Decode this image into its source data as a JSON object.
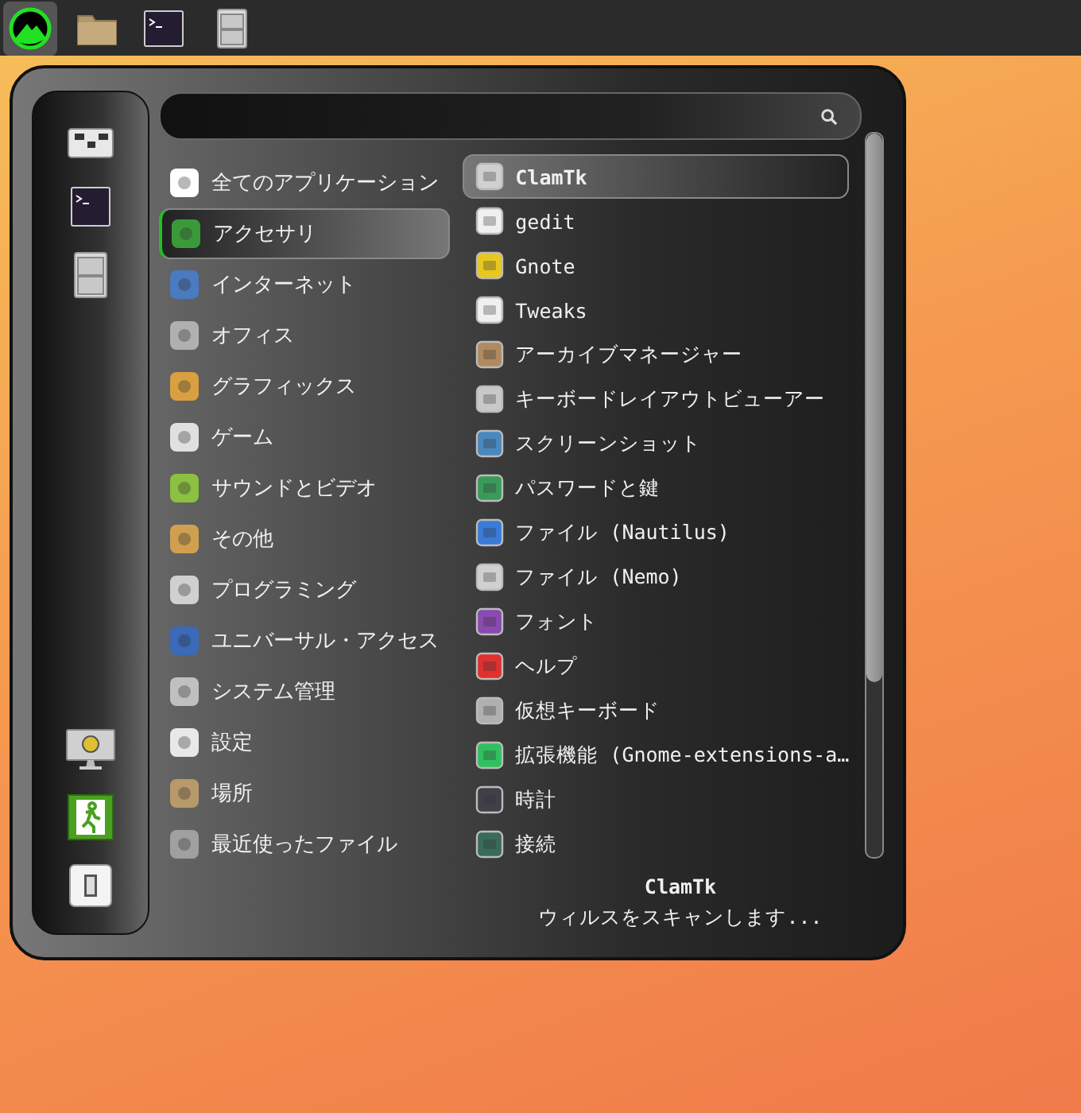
{
  "categories": [
    {
      "label": "全てのアプリケーション",
      "selected": false
    },
    {
      "label": "アクセサリ",
      "selected": true
    },
    {
      "label": "インターネット",
      "selected": false
    },
    {
      "label": "オフィス",
      "selected": false
    },
    {
      "label": "グラフィックス",
      "selected": false
    },
    {
      "label": "ゲーム",
      "selected": false
    },
    {
      "label": "サウンドとビデオ",
      "selected": false
    },
    {
      "label": "その他",
      "selected": false
    },
    {
      "label": "プログラミング",
      "selected": false
    },
    {
      "label": "ユニバーサル・アクセス",
      "selected": false
    },
    {
      "label": "システム管理",
      "selected": false
    },
    {
      "label": "設定",
      "selected": false
    },
    {
      "label": "場所",
      "selected": false
    },
    {
      "label": "最近使ったファイル",
      "selected": false
    }
  ],
  "apps": [
    {
      "label": "ClamTk",
      "selected": true
    },
    {
      "label": "gedit",
      "selected": false
    },
    {
      "label": "Gnote",
      "selected": false
    },
    {
      "label": "Tweaks",
      "selected": false
    },
    {
      "label": "アーカイブマネージャー",
      "selected": false
    },
    {
      "label": "キーボードレイアウトビューアー",
      "selected": false
    },
    {
      "label": "スクリーンショット",
      "selected": false
    },
    {
      "label": "パスワードと鍵",
      "selected": false
    },
    {
      "label": "ファイル (Nautilus)",
      "selected": false
    },
    {
      "label": "ファイル (Nemo)",
      "selected": false
    },
    {
      "label": "フォント",
      "selected": false
    },
    {
      "label": "ヘルプ",
      "selected": false
    },
    {
      "label": "仮想キーボード",
      "selected": false
    },
    {
      "label": "拡張機能 (Gnome-extensions-a…",
      "selected": false
    },
    {
      "label": "時計",
      "selected": false
    },
    {
      "label": "接続",
      "selected": false
    }
  ],
  "description": {
    "title": "ClamTk",
    "text": "ウィルスをスキャンします..."
  }
}
